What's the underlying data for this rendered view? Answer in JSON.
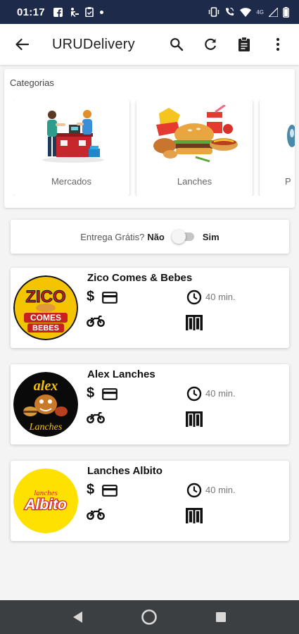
{
  "status_bar": {
    "time": "01:17",
    "left_icons": [
      "facebook-icon",
      "accessibility-icon",
      "clipboard-check-icon",
      "notification-dot-icon"
    ],
    "right_icons": [
      "vibrate-icon",
      "wifi-calling-icon",
      "wifi-icon",
      "network-4g-icon",
      "signal-icon",
      "battery-icon"
    ],
    "network_label": "4G"
  },
  "app_bar": {
    "title": "URUDelivery",
    "back_icon": "arrow-left-icon",
    "actions": [
      "search-icon",
      "refresh-icon",
      "clipboard-icon",
      "more-vert-icon"
    ]
  },
  "categories": {
    "heading": "Categorias",
    "items": [
      {
        "label": "Mercados",
        "icon": "market-illustration"
      },
      {
        "label": "Lanches",
        "icon": "snacks-illustration"
      },
      {
        "label": "P",
        "icon": "partial-illustration"
      }
    ]
  },
  "free_delivery": {
    "question": "Entrega Grátis?",
    "no_label": "Não",
    "yes_label": "Sim",
    "enabled": false
  },
  "restaurants": [
    {
      "name": "Zico Comes & Bebes",
      "price_symbol": "$",
      "time": "40 min.",
      "logo_text_top": "ZICO",
      "logo_text_mid": "COMES",
      "logo_text_bot": "BEBES"
    },
    {
      "name": "Alex Lanches",
      "price_symbol": "$",
      "time": "40 min.",
      "logo_text_top": "alex",
      "logo_text_bot": "Lanches"
    },
    {
      "name": "Lanches Albito",
      "price_symbol": "$",
      "time": "40 min.",
      "logo_text_top": "lanches",
      "logo_text_bot": "Albito"
    }
  ],
  "colors": {
    "status_bar": "#1e2a4a",
    "nav_bar": "#3c3f41",
    "zico_red": "#c8201e",
    "zico_yellow": "#f5c400",
    "albito_yellow": "#ffe100",
    "albito_red": "#d4202a"
  },
  "nav_bar": {
    "buttons": [
      "back-triangle-icon",
      "home-circle-icon",
      "recents-square-icon"
    ]
  }
}
